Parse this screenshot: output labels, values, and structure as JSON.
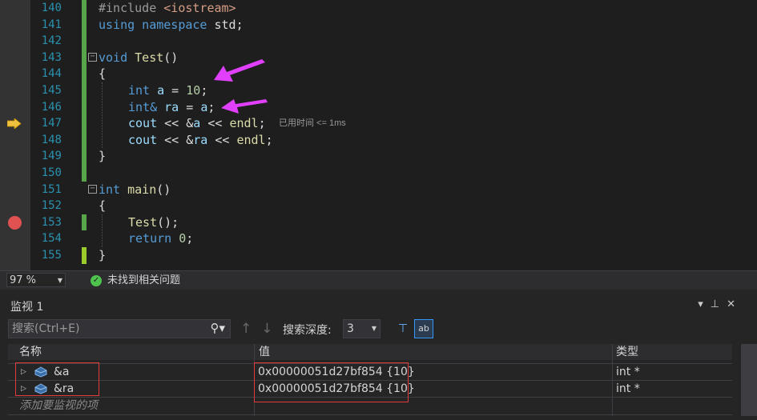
{
  "editor": {
    "lines": [
      {
        "num": "140"
      },
      {
        "num": "141"
      },
      {
        "num": "142"
      },
      {
        "num": "143"
      },
      {
        "num": "144"
      },
      {
        "num": "145"
      },
      {
        "num": "146"
      },
      {
        "num": "147"
      },
      {
        "num": "148"
      },
      {
        "num": "149"
      },
      {
        "num": "150"
      },
      {
        "num": "151"
      },
      {
        "num": "152"
      },
      {
        "num": "153"
      },
      {
        "num": "154"
      },
      {
        "num": "155"
      }
    ],
    "code": {
      "l140_a": "#include",
      "l140_b": " <iostream>",
      "l141_a": "using",
      "l141_b": " namespace",
      "l141_c": " std",
      "l141_d": ";",
      "l143_a": "void",
      "l143_b": " Test",
      "l143_c": "()",
      "l144": "{",
      "l145_a": "int",
      "l145_b": " a",
      "l145_c": " = ",
      "l145_d": "10",
      "l145_e": ";",
      "l146_a": "int&",
      "l146_b": " ra",
      "l146_c": " = ",
      "l146_d": "a",
      "l146_e": ";",
      "l147_a": "cout",
      "l147_b": " << &",
      "l147_c": "a",
      "l147_d": " << ",
      "l147_e": "endl",
      "l147_f": ";",
      "l148_a": "cout",
      "l148_b": " << &",
      "l148_c": "ra",
      "l148_d": " << ",
      "l148_e": "endl",
      "l148_f": ";",
      "l149": "}",
      "l151_a": "int",
      "l151_b": " main",
      "l151_c": "()",
      "l152": "{",
      "l153_a": "Test",
      "l153_b": "();",
      "l154_a": "return",
      "l154_b": " 0",
      "l154_c": ";",
      "l155": "}"
    },
    "perf_tip": "已用时间 <= 1ms"
  },
  "statusbar": {
    "zoom": "97 %",
    "issues": "未找到相关问题"
  },
  "watch": {
    "title": "监视 1",
    "search_placeholder": "搜索(Ctrl+E)",
    "depth_label": "搜索深度:",
    "depth_value": "3",
    "columns": {
      "name": "名称",
      "value": "值",
      "type": "类型"
    },
    "rows": [
      {
        "name": "&a",
        "value": "0x00000051d27bf854 {10}",
        "type": "int *"
      },
      {
        "name": "&ra",
        "value": "0x00000051d27bf854 {10}",
        "type": "int *"
      }
    ],
    "add_placeholder": "添加要监视的项"
  },
  "colors": {
    "keyword": "#569cd6",
    "function": "#dcdcaa",
    "variable": "#9cdcfe",
    "number": "#b5cea8",
    "line_number": "#2b91af",
    "annotation_arrow": "#e040fb",
    "annotation_box": "#e13c3c"
  }
}
